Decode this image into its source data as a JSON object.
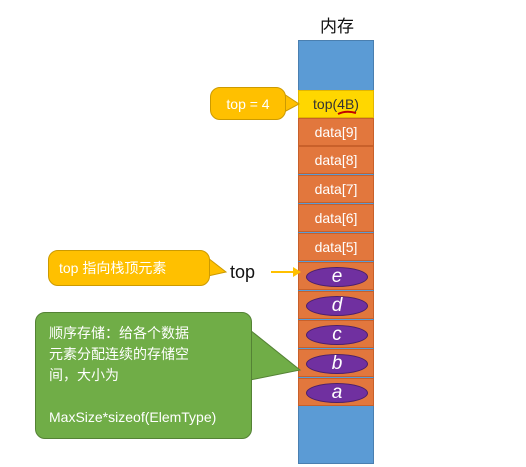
{
  "memory": {
    "title": "内存",
    "top_cell": "top(4B)",
    "data_cells": [
      "data[9]",
      "data[8]",
      "data[7]",
      "data[6]",
      "data[5]"
    ],
    "elements": [
      "e",
      "d",
      "c",
      "b",
      "a"
    ]
  },
  "callouts": {
    "top_value": "top = 4",
    "top_points_to": "top 指向栈顶元素",
    "storage_line1": "顺序存储：给各个数据",
    "storage_line2": "元素分配连续的存储空",
    "storage_line3": "间，大小为",
    "storage_formula": "MaxSize*sizeof(ElemType)"
  },
  "pointer_label": "top",
  "colors": {
    "memory_blue": "#5b9bd5",
    "cell_orange": "#e2773d",
    "top_yellow": "#ffd700",
    "callout_yellow": "#ffc000",
    "callout_green": "#70ad47",
    "element_purple": "#7030a0",
    "underline_red": "#c00000"
  }
}
